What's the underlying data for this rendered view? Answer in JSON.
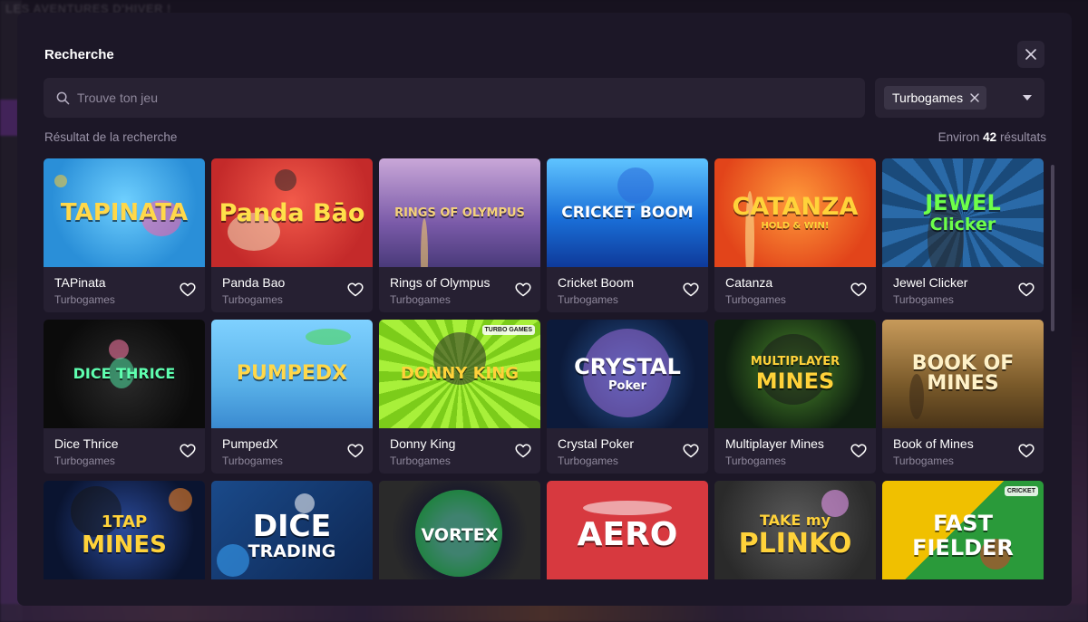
{
  "backdrop": {
    "banner_text": "LES AVENTURES D'HIVER !"
  },
  "modal": {
    "title": "Recherche",
    "close_icon": "close-icon"
  },
  "search": {
    "placeholder": "Trouve ton jeu",
    "value": "",
    "icon": "search-icon"
  },
  "filter": {
    "selected_chip": "Turbogames",
    "chip_remove_icon": "close-icon",
    "dropdown_icon": "caret-down-icon"
  },
  "results": {
    "label": "Résultat de la recherche",
    "prefix": "Environ",
    "count": "42",
    "suffix": "résultats"
  },
  "games": [
    {
      "name": "TAPinata",
      "provider": "Turbogames",
      "art_title": "TAPINATA",
      "favorite": false
    },
    {
      "name": "Panda Bao",
      "provider": "Turbogames",
      "art_title": "Panda Bāo",
      "favorite": false
    },
    {
      "name": "Rings of Olympus",
      "provider": "Turbogames",
      "art_title": "RINGS OF OLYMPUS",
      "favorite": false
    },
    {
      "name": "Cricket Boom",
      "provider": "Turbogames",
      "art_title": "CRICKET BOOM",
      "favorite": false
    },
    {
      "name": "Catanza",
      "provider": "Turbogames",
      "art_title": "CATANZA",
      "art_subtitle": "HOLD & WIN!",
      "favorite": false
    },
    {
      "name": "Jewel Clicker",
      "provider": "Turbogames",
      "art_title": "JEWEL",
      "art_subtitle": "Clicker",
      "favorite": false
    },
    {
      "name": "Dice Thrice",
      "provider": "Turbogames",
      "art_title": "DICE THRICE",
      "favorite": false
    },
    {
      "name": "PumpedX",
      "provider": "Turbogames",
      "art_title": "PUMPEDX",
      "favorite": false
    },
    {
      "name": "Donny King",
      "provider": "Turbogames",
      "art_title": "DONNY KING",
      "art_badge": "TURBO GAMES",
      "favorite": false
    },
    {
      "name": "Crystal Poker",
      "provider": "Turbogames",
      "art_title": "CRYSTAL",
      "art_subtitle": "Poker",
      "favorite": false
    },
    {
      "name": "Multiplayer Mines",
      "provider": "Turbogames",
      "art_title": "MULTIPLAYER",
      "art_subtitle": "MINES",
      "favorite": false
    },
    {
      "name": "Book of Mines",
      "provider": "Turbogames",
      "art_title": "BOOK OF MINES",
      "favorite": false
    },
    {
      "name": "",
      "provider": "",
      "art_title": "1TAP",
      "art_subtitle": "MINES",
      "favorite": false
    },
    {
      "name": "",
      "provider": "",
      "art_title": "DICE",
      "art_subtitle": "TRADING",
      "favorite": false
    },
    {
      "name": "",
      "provider": "",
      "art_title": "VORTEX",
      "favorite": false
    },
    {
      "name": "",
      "provider": "",
      "art_title": "AERO",
      "favorite": false
    },
    {
      "name": "",
      "provider": "",
      "art_title": "TAKE my",
      "art_subtitle": "PLINKO",
      "favorite": false
    },
    {
      "name": "",
      "provider": "",
      "art_title": "FAST",
      "art_subtitle": "FIELDER",
      "art_badge": "CRICKET",
      "favorite": false
    }
  ],
  "icons": {
    "favorite": "heart-icon"
  }
}
